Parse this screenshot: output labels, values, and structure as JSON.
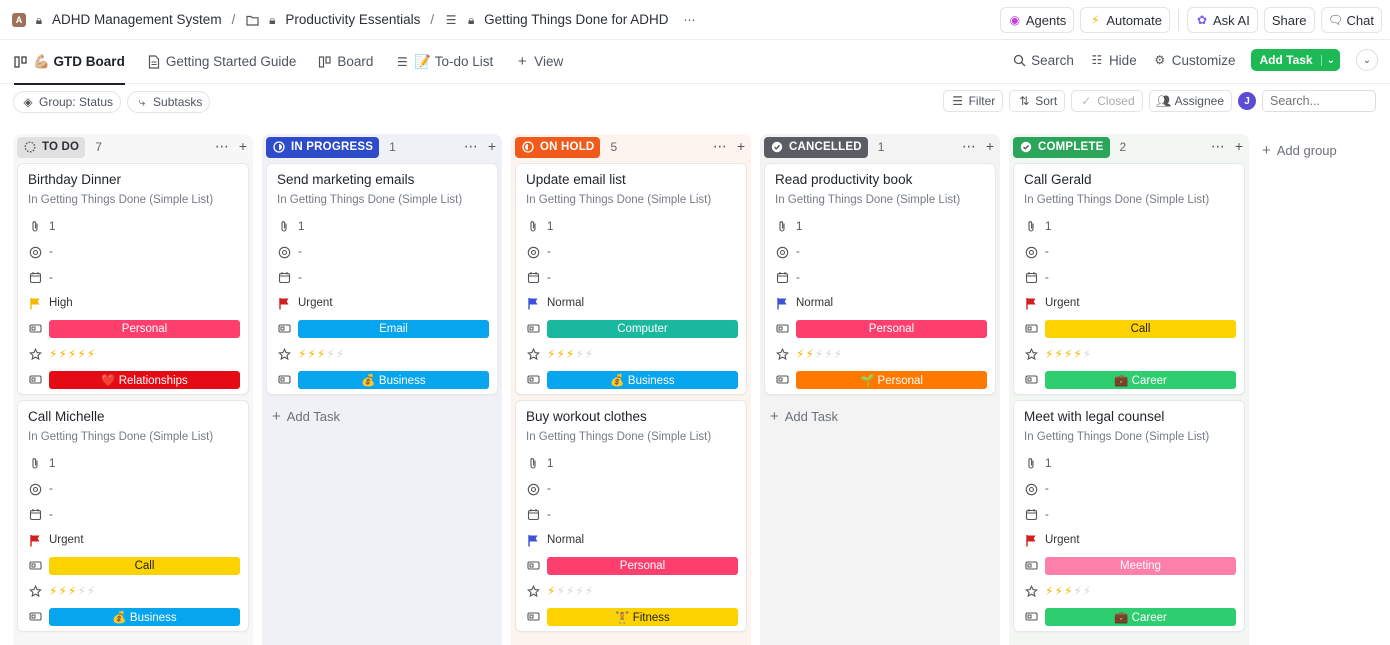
{
  "breadcrumb": {
    "workspace_initial": "A",
    "items": [
      "ADHD Management System",
      "Productivity Essentials",
      "Getting Things Done for ADHD"
    ]
  },
  "top_actions": {
    "agents": "Agents",
    "automate": "Automate",
    "ask_ai": "Ask AI",
    "share": "Share",
    "chat": "Chat"
  },
  "views": {
    "tabs": [
      {
        "label": "💪🏼 GTD Board"
      },
      {
        "label": "Getting Started Guide"
      },
      {
        "label": "Board"
      },
      {
        "label": "📝 To-do List"
      },
      {
        "label": "View"
      }
    ],
    "search": "Search",
    "hide": "Hide",
    "customize": "Customize",
    "add_task": "Add Task"
  },
  "filters": {
    "group": "Group: Status",
    "subtasks": "Subtasks",
    "filter": "Filter",
    "sort": "Sort",
    "closed": "Closed",
    "assignee": "Assignee",
    "avatar": "J",
    "search_placeholder": "Search..."
  },
  "board": {
    "add_task_label": "Add Task",
    "add_group_label": "Add group",
    "columns": [
      {
        "status": "TO DO",
        "count": "7",
        "color": "#e0e0e0",
        "bg": "#f7f7f8",
        "text": "#2b2f36",
        "icon": "dotted-circle",
        "cards": [
          {
            "title": "Birthday Dinner",
            "location": "In Getting Things Done (Simple List)",
            "attachments": "1",
            "assignee": "-",
            "due": "-",
            "priority": "High",
            "priority_color": "#f5b800",
            "category": "Personal",
            "category_color": "#fd3f6e",
            "category_dark": false,
            "energy": 5,
            "area": "❤️ Relationships",
            "area_color": "#e40b14",
            "area_dark": false
          },
          {
            "title": "Call Michelle",
            "location": "In Getting Things Done (Simple List)",
            "attachments": "1",
            "assignee": "-",
            "due": "-",
            "priority": "Urgent",
            "priority_color": "#d11f1f",
            "category": "Call",
            "category_color": "#fcd300",
            "category_dark": true,
            "energy": 3,
            "area": "💰 Business",
            "area_color": "#08a5ef",
            "area_dark": false
          }
        ]
      },
      {
        "status": "IN PROGRESS",
        "count": "1",
        "color": "#2e4cc9",
        "bg": "#f0f1f7",
        "text": "#fff",
        "icon": "progress-circle",
        "cards": [
          {
            "title": "Send marketing emails",
            "location": "In Getting Things Done (Simple List)",
            "attachments": "1",
            "assignee": "-",
            "due": "-",
            "priority": "Urgent",
            "priority_color": "#d11f1f",
            "category": "Email",
            "category_color": "#08a5ef",
            "category_dark": false,
            "energy": 3,
            "area": "💰 Business",
            "area_color": "#08a5ef",
            "area_dark": false
          }
        ]
      },
      {
        "status": "ON HOLD",
        "count": "5",
        "color": "#f05a1a",
        "bg": "#fdf4f0",
        "text": "#fff",
        "icon": "half-circle",
        "cards": [
          {
            "title": "Update email list",
            "location": "In Getting Things Done (Simple List)",
            "attachments": "1",
            "assignee": "-",
            "due": "-",
            "priority": "Normal",
            "priority_color": "#3d52d5",
            "category": "Computer",
            "category_color": "#1ab99f",
            "category_dark": false,
            "energy": 3,
            "area": "💰 Business",
            "area_color": "#08a5ef",
            "area_dark": false
          },
          {
            "title": "Buy workout clothes",
            "location": "In Getting Things Done (Simple List)",
            "attachments": "1",
            "assignee": "-",
            "due": "-",
            "priority": "Normal",
            "priority_color": "#3d52d5",
            "category": "Personal",
            "category_color": "#fd3f6e",
            "category_dark": false,
            "energy": 1,
            "area": "🏋️ Fitness",
            "area_color": "#fcd300",
            "area_dark": true
          }
        ]
      },
      {
        "status": "CANCELLED",
        "count": "1",
        "color": "#5a5d63",
        "bg": "#f3f3f4",
        "text": "#fff",
        "icon": "check-circle",
        "cards": [
          {
            "title": "Read productivity book",
            "location": "In Getting Things Done (Simple List)",
            "attachments": "1",
            "assignee": "-",
            "due": "-",
            "priority": "Normal",
            "priority_color": "#3d52d5",
            "category": "Personal",
            "category_color": "#fd3f6e",
            "category_dark": false,
            "energy": 2,
            "area": "🌱 Personal",
            "area_color": "#ff7800",
            "area_dark": false
          }
        ]
      },
      {
        "status": "COMPLETE",
        "count": "2",
        "color": "#2aa55a",
        "bg": "#f2f7f3",
        "text": "#fff",
        "icon": "check-circle",
        "cards": [
          {
            "title": "Call Gerald",
            "location": "In Getting Things Done (Simple List)",
            "attachments": "1",
            "assignee": "-",
            "due": "-",
            "priority": "Urgent",
            "priority_color": "#d11f1f",
            "category": "Call",
            "category_color": "#fcd300",
            "category_dark": true,
            "energy": 4,
            "area": "💼 Career",
            "area_color": "#2ecd6f",
            "area_dark": false
          },
          {
            "title": "Meet with legal counsel",
            "location": "In Getting Things Done (Simple List)",
            "attachments": "1",
            "assignee": "-",
            "due": "-",
            "priority": "Urgent",
            "priority_color": "#d11f1f",
            "category": "Meeting",
            "category_color": "#ff7fab",
            "category_dark": false,
            "energy": 3,
            "area": "💼 Career",
            "area_color": "#2ecd6f",
            "area_dark": false
          }
        ]
      }
    ]
  }
}
